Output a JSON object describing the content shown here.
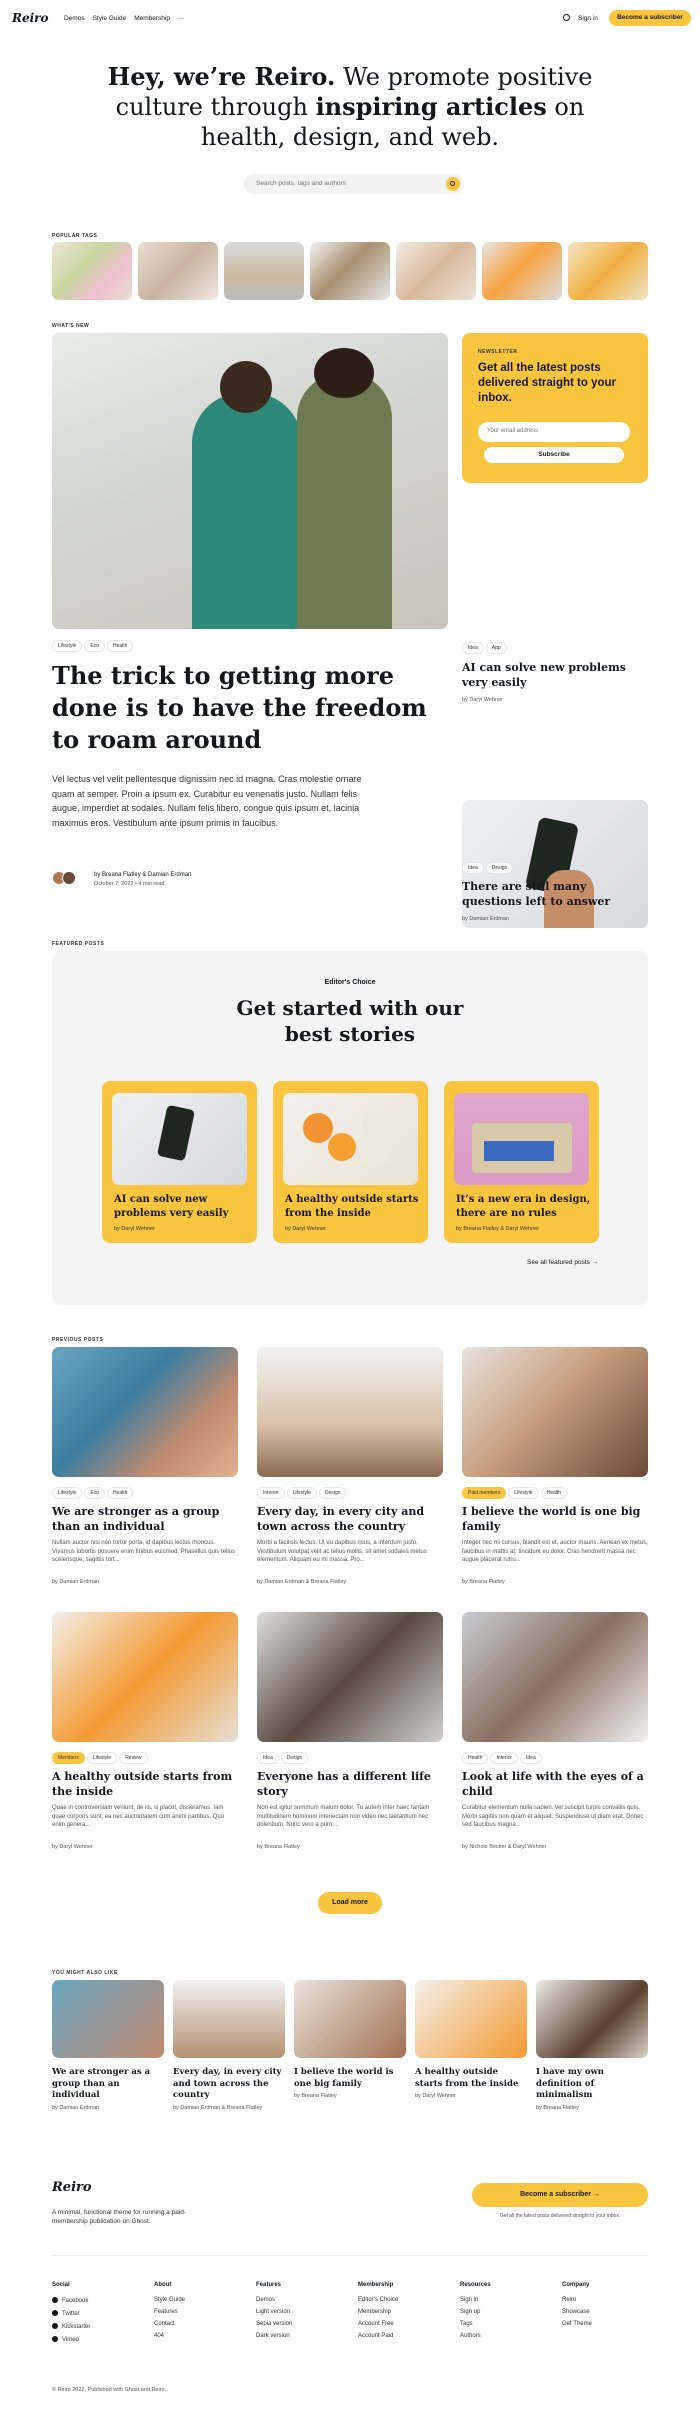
{
  "nav": {
    "logo": "Reiro",
    "links": [
      "Demos",
      "Style Guide",
      "Membership"
    ],
    "more": "···",
    "signin": "Sign in",
    "subscribe": "Become a subscriber"
  },
  "hero": {
    "line1a": "Hey, we’re Reiro.",
    "line1b": " We promote positive",
    "line2a": "culture through ",
    "line2b": "inspiring articles",
    "line2c": " on",
    "line3": "health, design, and web.",
    "search_placeholder": "Search posts, tags and authors"
  },
  "popular_tags": {
    "label": "POPULAR TAGS"
  },
  "whats_new": {
    "label": "WHAT'S NEW",
    "main": {
      "tags": [
        "Lifestyle",
        "Eco",
        "Health"
      ],
      "title": "The trick to getting more done is to have the freedom to roam around",
      "excerpt": "Vel lectus vel velit pellentesque dignissim nec id magna. Cras molestie ornare quam at semper. Proin a ipsum ex. Curabitur eu venenatis justo. Nullam felis augue, imperdiet at sodales. Nullam felis libero, congue quis ipsum et, lacinia maximus eros. Vestibulum ante ipsum primis in faucibus.",
      "authors": "by Breana Flatley & Damian Erdman",
      "meta": "October 7, 2022 • 4 min read"
    },
    "newsletter": {
      "label": "NEWSLETTER",
      "title": "Get all the latest posts delivered straight to your inbox.",
      "placeholder": "Your email address",
      "button": "Subscribe"
    },
    "side": [
      {
        "tags": [
          "Idea",
          "App"
        ],
        "title": "AI can solve new problems very easily",
        "author": "by Daryl Wehner"
      },
      {
        "tags": [
          "Idea",
          "Design"
        ],
        "title": "There are still many questions left to answer",
        "author": "by Damian Erdman"
      }
    ]
  },
  "featured": {
    "label": "FEATURED POSTS",
    "kicker": "Editor's Choice",
    "title": "Get started with our best stories",
    "cards": [
      {
        "title": "AI can solve new problems very easily",
        "author": "by Daryl Wehner"
      },
      {
        "title": "A healthy outside starts from the inside",
        "author": "by Daryl Wehner"
      },
      {
        "title": "It’s a new era in design, there are no rules",
        "author": "by Breana Flatley & Daryl Wehner"
      }
    ],
    "see_all": "See all featured posts →"
  },
  "previous": {
    "label": "PREVIOUS POSTS",
    "posts": [
      {
        "tags": [
          "Lifestyle",
          "Eco",
          "Health"
        ],
        "title": "We are stronger as a group than an individual",
        "excerpt": "Nullam auctor nisi non tortor porta, id dapibus lectus rhoncus. Vivamus lobortis posuere enim finibus euismod. Phasellus quis tellus scelerisque, sagittis tort...",
        "author": "by Damian Erdman"
      },
      {
        "tags": [
          "Interior",
          "Lifestyle",
          "Design"
        ],
        "title": "Every day, in every city and town across the country",
        "excerpt": "Morbi a facilisis lectus. Ut eu dapibus risus, a interdum justo. Vestibulum volutpat velit ac tellus mollis, sit amet sodales metus elementum. Aliquam eu mi massa. Pro...",
        "author": "by Damian Erdman & Breana Flatley"
      },
      {
        "tags": [
          "Paid members",
          "Lifestyle",
          "Health"
        ],
        "title": "I believe the world is one big family",
        "excerpt": "Integer nec mi cursus, blandit est et, auctor mauris. Aenean ex metus, faucibus in mattis at, tincidunt eu dolor. Cras hendrerit massa nec augue placerat rutru...",
        "author": "by Breana Flatley"
      },
      {
        "tags": [
          "Members",
          "Lifestyle",
          "Review"
        ],
        "title": "A healthy outside starts from the inside",
        "excerpt": "Quae in controversiam veniunt, de iis, si placet, disseramus. Iam quae corporis sunt, ea nec auctoritatem cum animi partibus. Quo enim genera...",
        "author": "by Daryl Wehner"
      },
      {
        "tags": [
          "Idea",
          "Design"
        ],
        "title": "Everyone has a different life story",
        "excerpt": "Non est igitur summum malum dolor. Tu autem inter haec tantam multitudinem hominum interiectam non video nec laetantium nec dolentium. Nunc vero a prim...",
        "author": "by Breana Flatley"
      },
      {
        "tags": [
          "Health",
          "Interior",
          "Idea"
        ],
        "title": "Look at life with the eyes of a child",
        "excerpt": "Curabitur elementum nulla sapien, vel suscipit turpis convallis quis. Morbi sagittis non quam et aliquet. Suspendisse ut diam erat. Donec sed faucibus magna...",
        "author": "by Nichole Becker & Daryl Wehner"
      }
    ],
    "load_more": "Load more"
  },
  "also": {
    "label": "YOU MIGHT ALSO LIKE",
    "items": [
      {
        "title": "We are stronger as a group than an individual",
        "author": "by Damian Erdman"
      },
      {
        "title": "Every day, in every city and town across the country",
        "author": "by Damian Erdman & Breana Flatley"
      },
      {
        "title": "I believe the world is one big family",
        "author": "by Breana Flatley"
      },
      {
        "title": "A healthy outside starts from the inside",
        "author": "by Daryl Wehner"
      },
      {
        "title": "I have my own definition of minimalism",
        "author": "by Breana Flatley"
      }
    ]
  },
  "footer": {
    "logo": "Reiro",
    "desc": "A minimal, functional theme for running a paid-membership publication on Ghost.",
    "subscribe": "Become a subscriber →",
    "sub_note": "Get all the latest posts delivered straight to your inbox.",
    "cols": [
      {
        "h": "Social",
        "items": [
          "Facebook",
          "Twitter",
          "Kickstarter",
          "Vimeo"
        ]
      },
      {
        "h": "About",
        "items": [
          "Style Guide",
          "Features",
          "Contact",
          "404"
        ]
      },
      {
        "h": "Features",
        "items": [
          "Demos",
          "Light version",
          "Sepia version",
          "Dark version"
        ]
      },
      {
        "h": "Membership",
        "items": [
          "Editor's Choice",
          "Membership",
          "Account Free",
          "Account Paid"
        ]
      },
      {
        "h": "Resources",
        "items": [
          "Sign in",
          "Sign up",
          "Tags",
          "Authors"
        ]
      },
      {
        "h": "Company",
        "items": [
          "Reiro",
          "Showcase",
          "Get Theme"
        ]
      }
    ],
    "copyright": "© Reiro 2022. Published with Ghost and Reiro."
  },
  "colors": {
    "accent": "#f9c53e",
    "text": "#15171a",
    "bg": "#ffffff",
    "featured_bg": "#f4f4f4"
  }
}
